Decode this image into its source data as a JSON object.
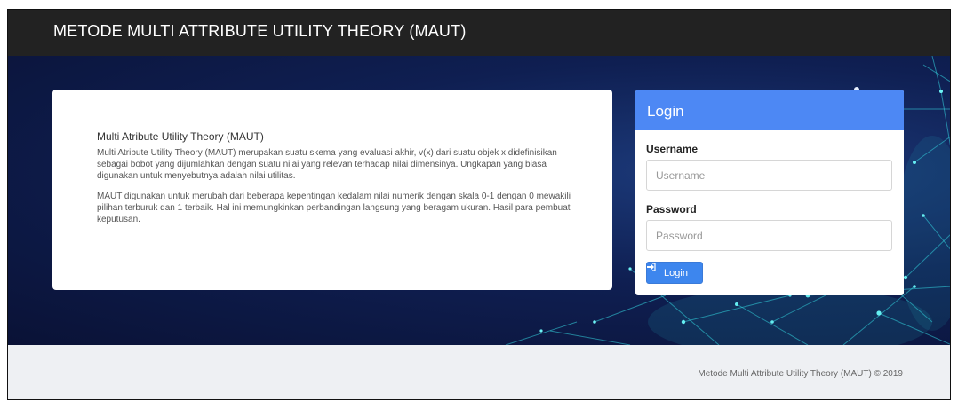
{
  "navbar": {
    "brand": "METODE MULTI ATTRIBUTE UTILITY THEORY (MAUT)"
  },
  "info": {
    "title": "Multi Atribute Utility Theory (MAUT)",
    "paragraph1": "Multi Atribute Utility Theory (MAUT) merupakan suatu skema yang evaluasi akhir, v(x) dari suatu objek x didefinisikan sebagai bobot yang dijumlahkan dengan suatu nilai yang relevan terhadap nilai dimensinya. Ungkapan yang biasa digunakan untuk menyebutnya adalah nilai utilitas.",
    "paragraph2": "MAUT digunakan untuk merubah dari beberapa kepentingan kedalam nilai numerik dengan skala 0-1 dengan 0 mewakili pilihan terburuk dan 1 terbaik. Hal ini memungkinkan perbandingan langsung yang beragam ukuran. Hasil para pembuat keputusan."
  },
  "login": {
    "header": "Login",
    "username_label": "Username",
    "username_placeholder": "Username",
    "username_value": "",
    "password_label": "Password",
    "password_placeholder": "Password",
    "password_value": "",
    "button_label": "Login",
    "button_icon": "sign-in-icon"
  },
  "footer": {
    "text": "Metode Multi Attribute Utility Theory (MAUT) © 2019"
  },
  "colors": {
    "navbar": "#222222",
    "login_header": "#4d88f4",
    "login_button": "#3d86ee",
    "hero_dark": "#0a1236",
    "network_glow": "#38e0e6"
  }
}
